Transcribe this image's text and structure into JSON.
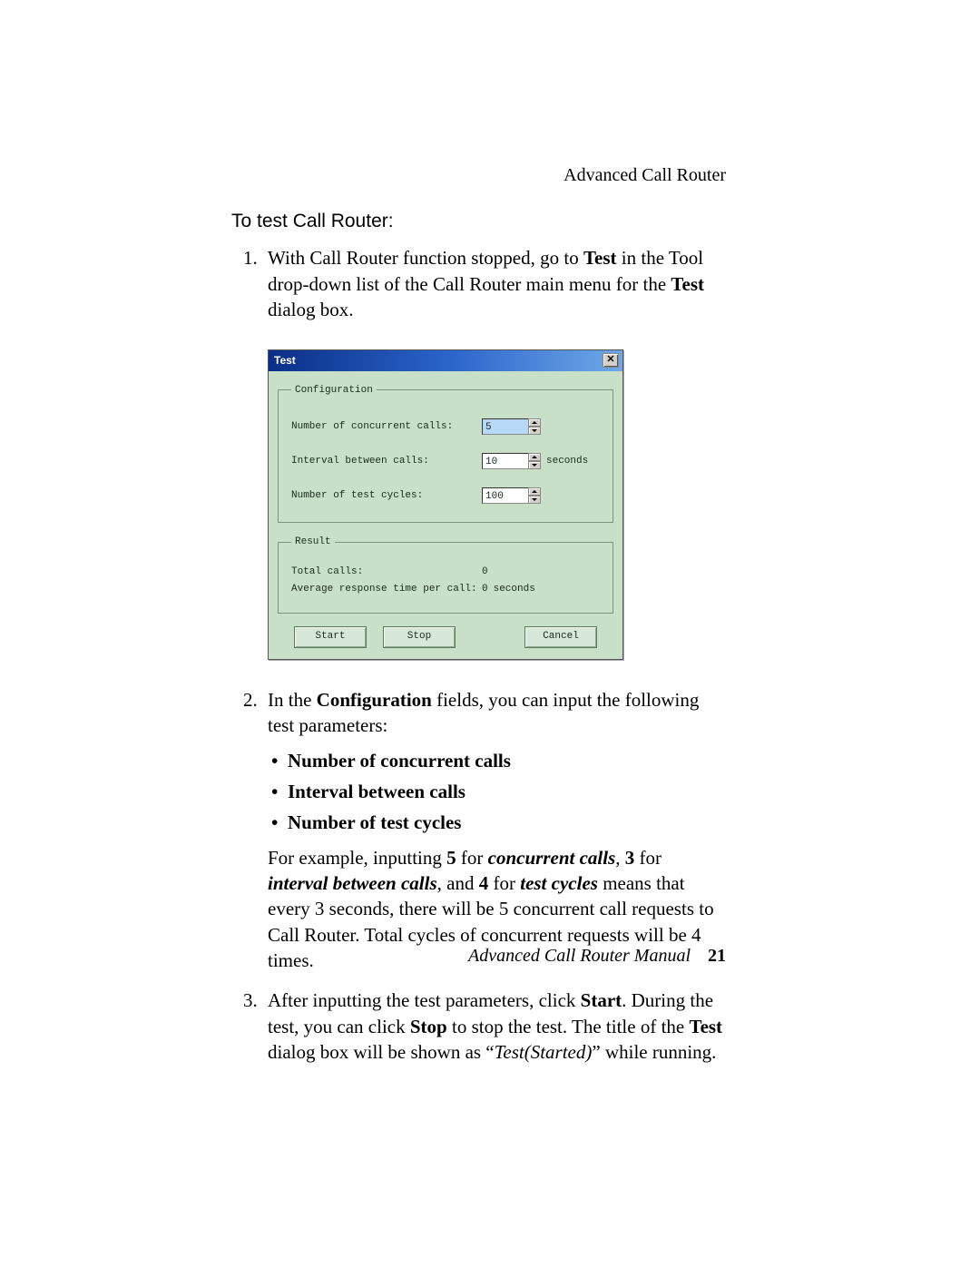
{
  "header": {
    "section": "Advanced Call Router"
  },
  "heading": "To test Call Router:",
  "step1": {
    "pre": "With Call Router function stopped, go to ",
    "b1": "Test",
    "mid": " in the Tool drop-down list of the Call Router main menu for the ",
    "b2": "Test",
    "post": " dialog box."
  },
  "dialog": {
    "title": "Test",
    "close": "✕",
    "config": {
      "legend": "Configuration",
      "l_conc": "Number of concurrent calls:",
      "v_conc": "5",
      "l_int": "Interval between calls:",
      "v_int": "10",
      "u_int": "seconds",
      "l_cyc": "Number of test cycles:",
      "v_cyc": "100"
    },
    "result": {
      "legend": "Result",
      "l_total": "Total calls:",
      "v_total": "0",
      "l_avg": "Average response time per call:",
      "v_avg": "0",
      "u_avg": "seconds"
    },
    "buttons": {
      "start": "Start",
      "stop": "Stop",
      "cancel": "Cancel"
    }
  },
  "step2": {
    "pre": "In the ",
    "b1": "Configuration",
    "post": " fields, you can input the following test parameters:",
    "bul1": "Number of concurrent calls",
    "bul2": "Interval between calls",
    "bul3": "Number of test cycles",
    "ex": {
      "a": "For example, inputting ",
      "b5": "5",
      "t1": " for ",
      "i1": "concurrent calls",
      "t2": ", ",
      "b3": "3",
      "t3": " for ",
      "i2": "interval between calls",
      "t4": ", and ",
      "b4": "4",
      "t5": " for ",
      "i3": "test cycles",
      "t6": " means that every 3 seconds, there will be 5 concurrent call requests to Call Router. Total cycles of concurrent requests will be 4 times."
    }
  },
  "step3": {
    "a": "After inputting the test parameters, click ",
    "b_start": "Start",
    "b": ". During the test, you can click ",
    "b_stop": "Stop",
    "c": " to stop the test. The title of the ",
    "b_test": "Test",
    "d": " dialog box will be shown as “",
    "i_started": "Test(Started)",
    "e": "” while running."
  },
  "footer": {
    "manual": "Advanced Call Router Manual",
    "page": "21"
  }
}
